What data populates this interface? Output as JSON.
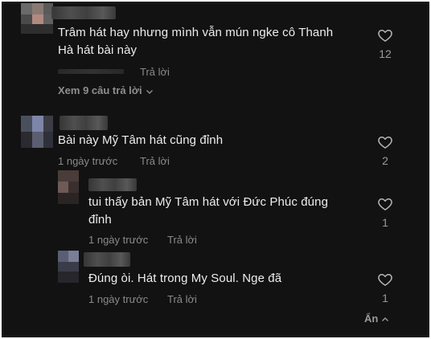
{
  "comments": [
    {
      "text_line1": "Trâm hát hay nhưng mình vẫn mún ngke cô Thanh",
      "text_line2": "Hà hát bài này",
      "reply_label": "Trả lời",
      "like_count": "12",
      "view_replies": "Xem 9 câu trả lời"
    },
    {
      "text": "Bài này Mỹ Tâm hát cũng đỉnh",
      "time": "1 ngày trước",
      "reply_label": "Trả lời",
      "like_count": "2",
      "replies": [
        {
          "text_line1": "tui thấy bản Mỹ Tâm hát với Đức Phúc đúng",
          "text_line2": "đỉnh",
          "time": "1 ngày trước",
          "reply_label": "Trả lời",
          "like_count": "1"
        },
        {
          "text": "Đúng òi. Hát trong My Soul. Nge đã",
          "time": "1 ngày trước",
          "reply_label": "Trả lời",
          "like_count": "1"
        }
      ],
      "hide_label": "Ẩn"
    }
  ],
  "icons": {
    "like": "heart-outline-icon",
    "expand": "chevron-down-icon",
    "collapse": "chevron-up-icon"
  },
  "colors": {
    "background": "#121212",
    "text": "#ededed",
    "muted": "#8a8a8a"
  }
}
